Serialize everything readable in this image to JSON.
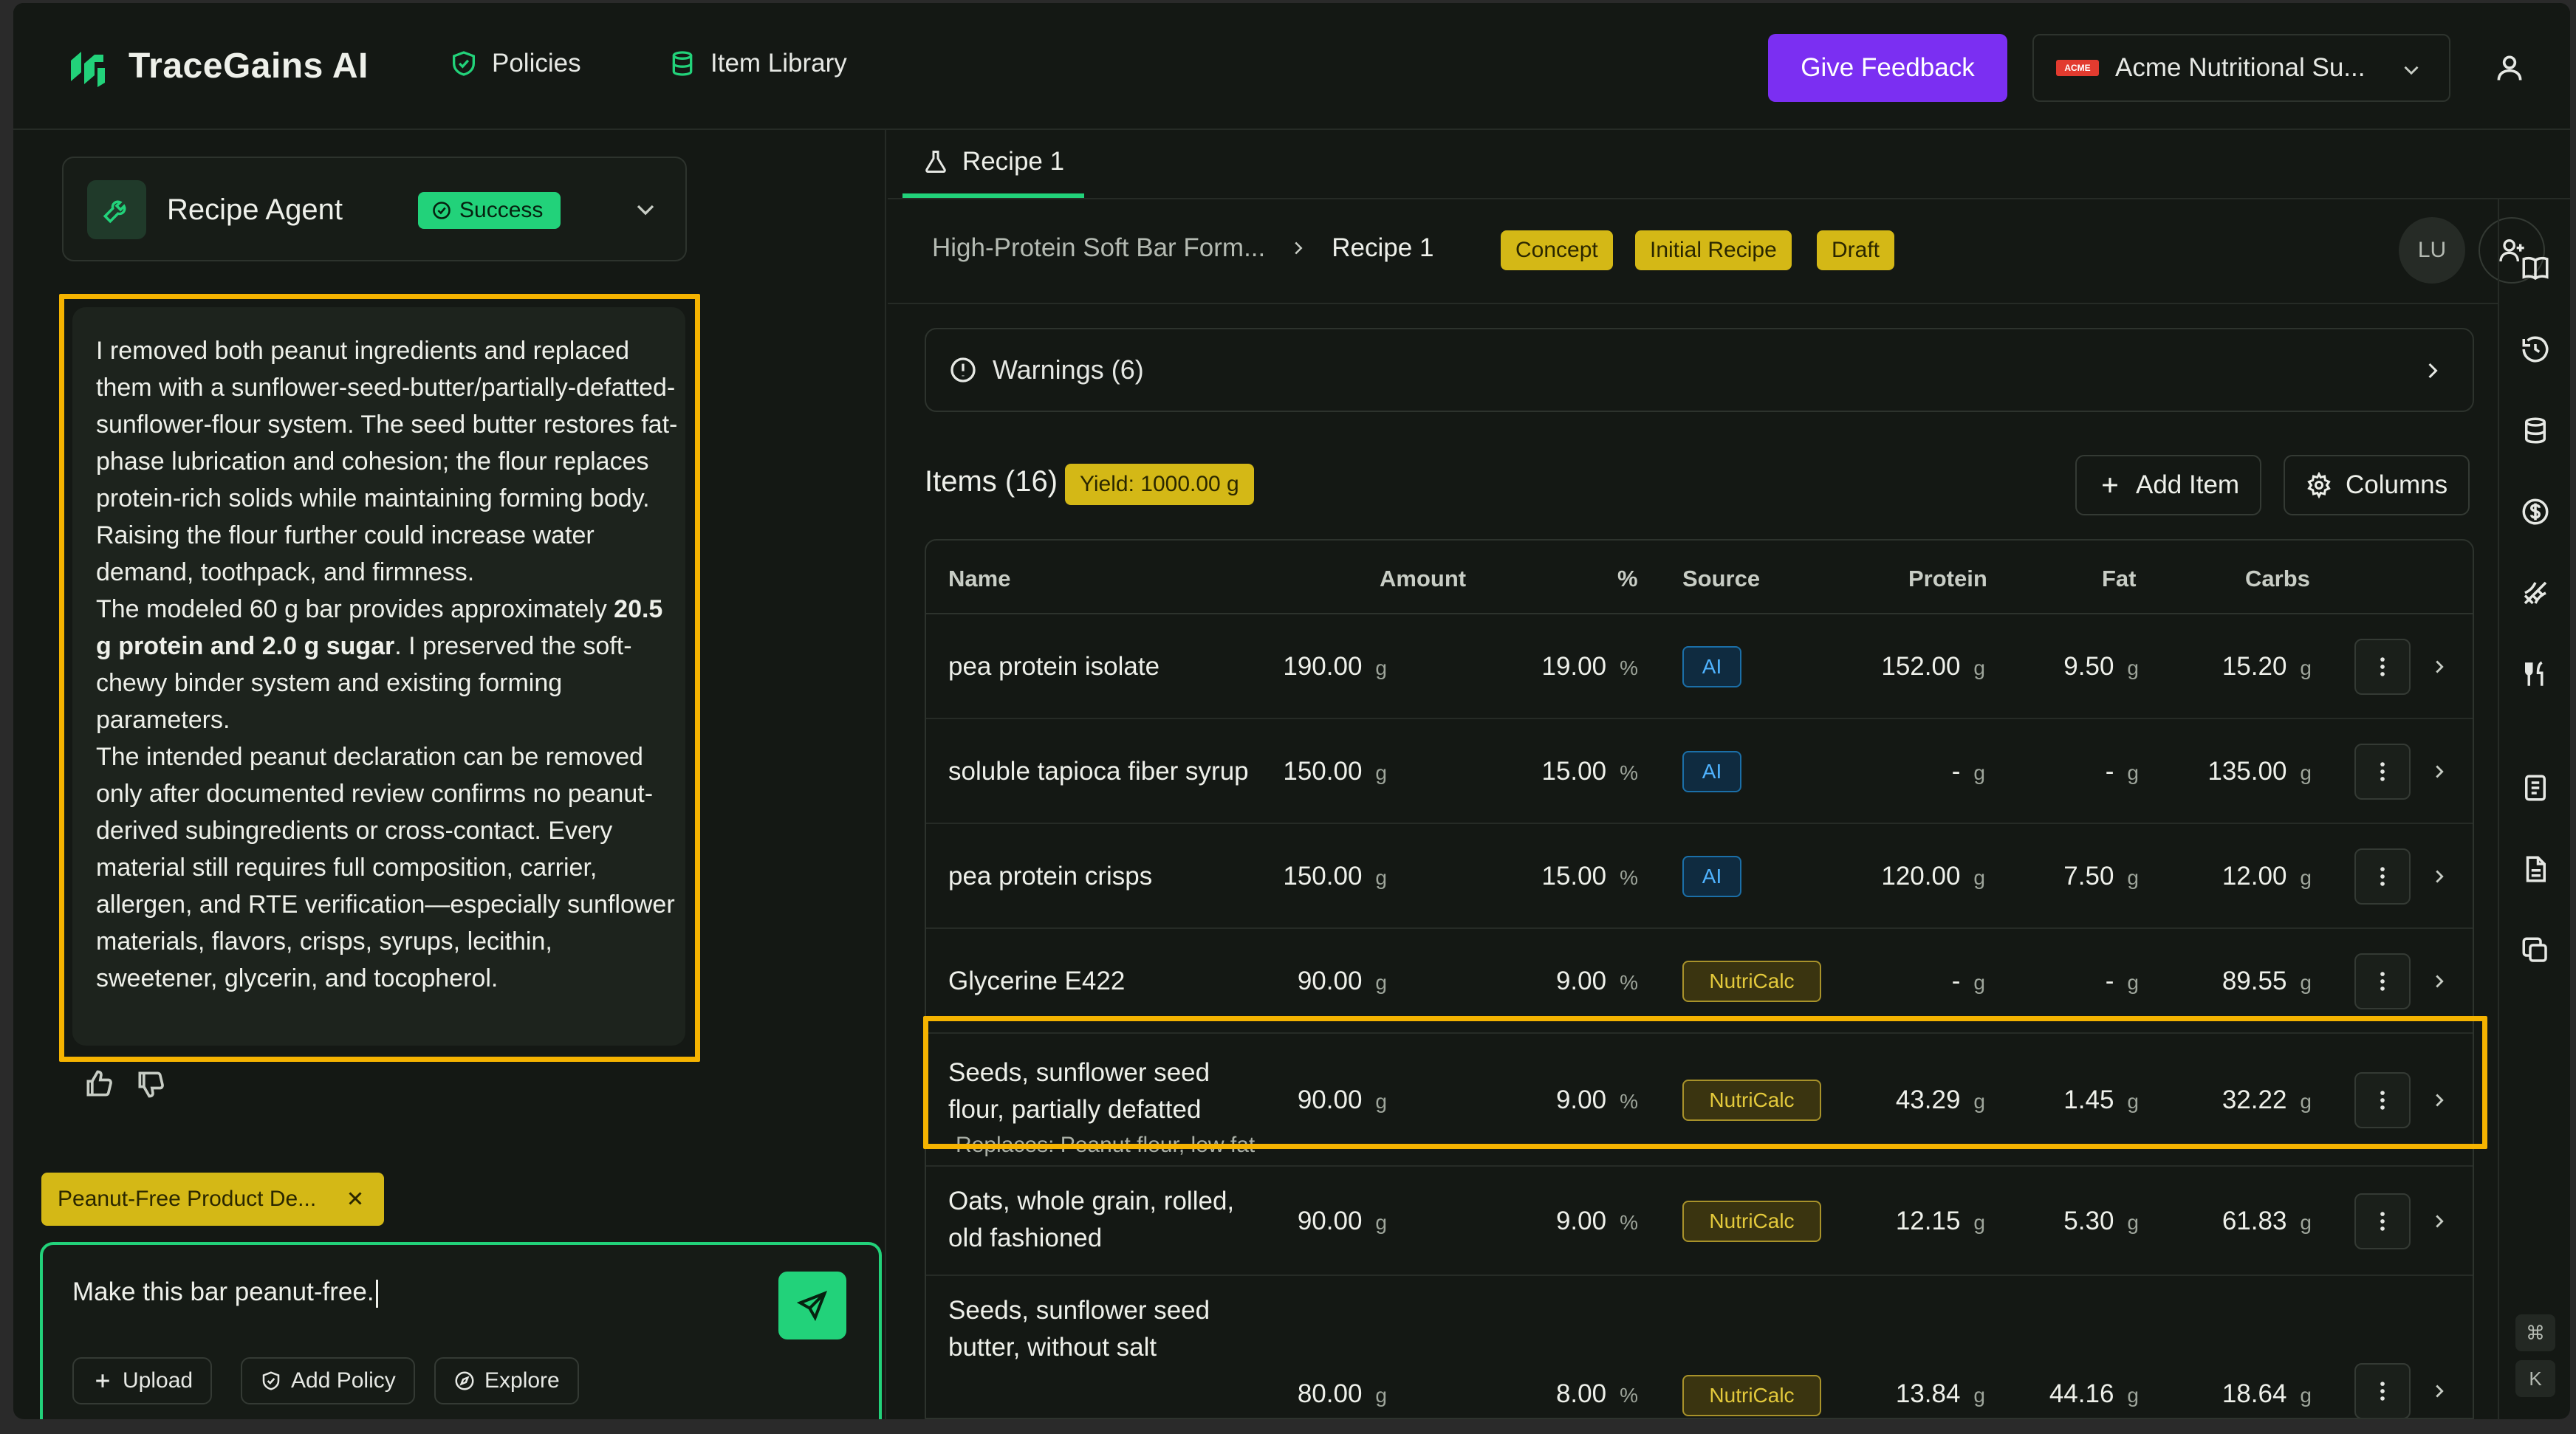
{
  "app": {
    "brand": "TraceGains AI",
    "nav": [
      {
        "label": "Policies",
        "icon": "shield-check-icon"
      },
      {
        "label": "Item Library",
        "icon": "database-icon"
      }
    ],
    "feedback_label": "Give Feedback",
    "org_name": "Acme Nutritional Su...",
    "org_logo_text": "ACME"
  },
  "agent": {
    "title": "Recipe Agent",
    "status": "Success",
    "message": {
      "p1": "I removed both peanut ingredients and replaced them with a sunflower-seed-butter/partially-defatted-sunflower-flour system. The seed butter restores fat-phase lubrication and cohesion; the flour replaces protein-rich solids while maintaining forming body. Raising the flour further could increase water demand, toothpack, and firmness.",
      "p2_a": "The modeled 60 g bar provides approximately ",
      "p2_bold": "20.5 g protein and 2.0 g sugar",
      "p2_b": ". I preserved the soft-chewy binder system and existing forming parameters.",
      "p3": "The intended peanut declaration can be removed only after documented review confirms no peanut-derived subingredients or cross-contact. Every material still requires full composition, carrier, allergen, and RTE verification—especially sunflower materials, flavors, crisps, syrups, lecithin, sweetener, glycerin, and tocopherol."
    },
    "context_chip": "Peanut-Free Product De...",
    "input_value": "Make this bar peanut-free.",
    "tools": [
      "Upload",
      "Add Policy",
      "Explore"
    ]
  },
  "recipe": {
    "tab_label": "Recipe 1",
    "breadcrumb_parent": "High-Protein Soft Bar Form...",
    "breadcrumb_current": "Recipe 1",
    "tags": [
      "Concept",
      "Initial Recipe",
      "Draft"
    ],
    "avatar_initials": "LU",
    "warnings_label": "Warnings (6)",
    "items_title": "Items (16)",
    "yield_label": "Yield: 1000.00 g",
    "add_item_label": "Add Item",
    "columns_label": "Columns",
    "columns": [
      "Name",
      "Amount",
      "%",
      "Source",
      "Protein",
      "Fat",
      "Carbs"
    ],
    "rows": [
      {
        "name": "pea protein isolate",
        "name2": "",
        "replaces": "",
        "amount": "190.00",
        "amount_unit": "g",
        "pct": "19.00",
        "pct_unit": "%",
        "source": "AI",
        "protein": "152.00",
        "fat": "9.50",
        "carbs": "15.20",
        "unit": "g"
      },
      {
        "name": "soluble tapioca fiber syrup",
        "name2": "",
        "replaces": "",
        "amount": "150.00",
        "amount_unit": "g",
        "pct": "15.00",
        "pct_unit": "%",
        "source": "AI",
        "protein": "-",
        "fat": "-",
        "carbs": "135.00",
        "unit": "g"
      },
      {
        "name": "pea protein crisps",
        "name2": "",
        "replaces": "",
        "amount": "150.00",
        "amount_unit": "g",
        "pct": "15.00",
        "pct_unit": "%",
        "source": "AI",
        "protein": "120.00",
        "fat": "7.50",
        "carbs": "12.00",
        "unit": "g"
      },
      {
        "name": "Glycerine E422",
        "name2": "",
        "replaces": "",
        "amount": "90.00",
        "amount_unit": "g",
        "pct": "9.00",
        "pct_unit": "%",
        "source": "NutriCalc",
        "protein": "-",
        "fat": "-",
        "carbs": "89.55",
        "unit": "g"
      },
      {
        "name": "Seeds, sunflower seed",
        "name2": "flour, partially defatted",
        "replaces": "Replaces: Peanut flour, low fat",
        "amount": "90.00",
        "amount_unit": "g",
        "pct": "9.00",
        "pct_unit": "%",
        "source": "NutriCalc",
        "protein": "43.29",
        "fat": "1.45",
        "carbs": "32.22",
        "unit": "g"
      },
      {
        "name": "Oats, whole grain, rolled,",
        "name2": "old fashioned",
        "replaces": "",
        "amount": "90.00",
        "amount_unit": "g",
        "pct": "9.00",
        "pct_unit": "%",
        "source": "NutriCalc",
        "protein": "12.15",
        "fat": "5.30",
        "carbs": "61.83",
        "unit": "g"
      },
      {
        "name": "Seeds, sunflower seed",
        "name2": "butter, without salt",
        "replaces": "",
        "amount": "80.00",
        "amount_unit": "g",
        "pct": "8.00",
        "pct_unit": "%",
        "source": "NutriCalc",
        "protein": "13.84",
        "fat": "44.16",
        "carbs": "18.64",
        "unit": "g"
      }
    ]
  },
  "shortcut_keys": [
    "⌘",
    "K"
  ],
  "colors": {
    "accent": "#22d27a",
    "feedback": "#7b2ff2",
    "tag": "#d4b816",
    "highlight": "#f5b300",
    "background": "#141814"
  }
}
